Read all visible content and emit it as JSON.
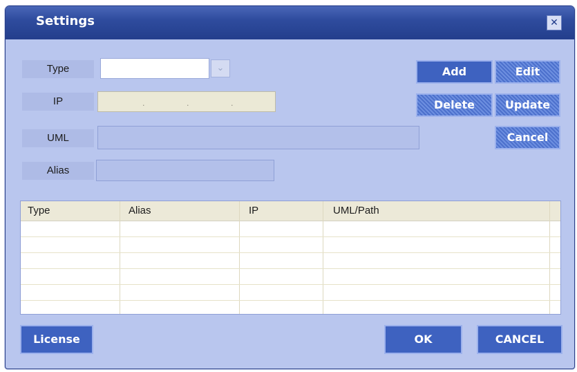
{
  "dialog": {
    "title": "Settings",
    "close_glyph": "✕"
  },
  "form": {
    "type_label": "Type",
    "ip_label": "IP",
    "uml_label": "UML",
    "alias_label": "Alias",
    "type_value": "",
    "uml_value": "",
    "alias_value": "",
    "dropdown_glyph": "⌄"
  },
  "actions": {
    "add": "Add",
    "edit": "Edit",
    "delete": "Delete",
    "update": "Update",
    "cancel": "Cancel"
  },
  "table": {
    "columns": [
      "Type",
      "Alias",
      "IP",
      "UML/Path"
    ],
    "rows": []
  },
  "footer": {
    "license": "License",
    "ok": "OK",
    "cancel": "CANCEL"
  },
  "colors": {
    "titlebar": "#2f4c9e",
    "panel": "#b9c6ee",
    "button": "#3e62c0"
  }
}
